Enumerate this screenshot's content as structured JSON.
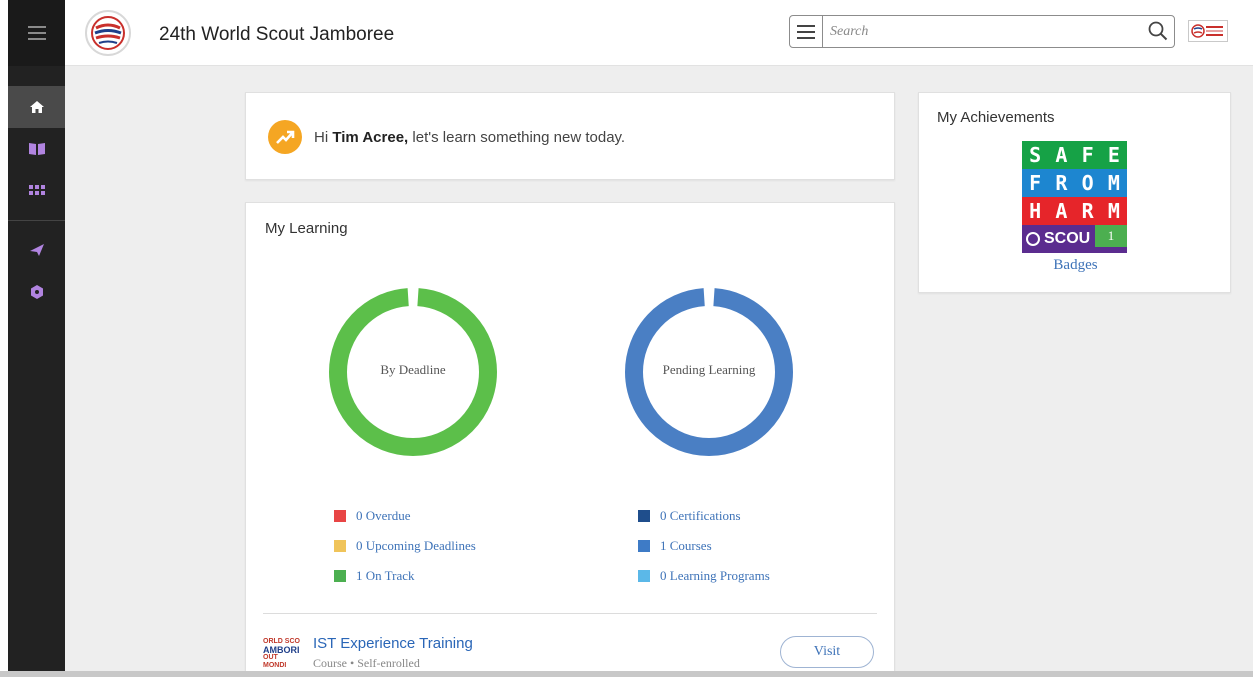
{
  "app": {
    "title": "24th World Scout Jamboree"
  },
  "sidebar": {
    "items": [
      {
        "name": "home",
        "icon": "home-icon",
        "active": true
      },
      {
        "name": "learning",
        "icon": "book-icon"
      },
      {
        "name": "apps",
        "icon": "grid-icon"
      },
      {
        "name": "send",
        "icon": "paper-plane-icon"
      },
      {
        "name": "badge",
        "icon": "hexagon-icon"
      }
    ],
    "accent": "#b184e0"
  },
  "search": {
    "placeholder": "Search"
  },
  "welcome": {
    "greeting_prefix": "Hi",
    "user_name": "Tim Acree,",
    "message": "let's learn something new today."
  },
  "my_learning": {
    "title": "My Learning",
    "donut_left_label": "By Deadline",
    "donut_right_label": "Pending Learning",
    "deadline_legend": [
      {
        "label": "0 Overdue",
        "color": "#e84545"
      },
      {
        "label": "0 Upcoming Deadlines",
        "color": "#f0c45a"
      },
      {
        "label": "1 On Track",
        "color": "#4caf50"
      }
    ],
    "pending_legend": [
      {
        "label": "0 Certifications",
        "color": "#1f4e8c"
      },
      {
        "label": "1 Courses",
        "color": "#3e7bc6"
      },
      {
        "label": "0 Learning Programs",
        "color": "#5bb8e8"
      }
    ],
    "course": {
      "thumb_lines": [
        "ORLD SCO",
        "AMBORI",
        "OUT MONDI"
      ],
      "title": "IST Experience Training",
      "meta": "Course • Self-enrolled",
      "action": "Visit"
    }
  },
  "achievements": {
    "title": "My Achievements",
    "badge_rows": [
      [
        "S",
        "A",
        "F",
        "E"
      ],
      [
        "F",
        "R",
        "O",
        "M"
      ],
      [
        "H",
        "A",
        "R",
        "M"
      ]
    ],
    "badge_footer": "SCOU",
    "badge_count": "1",
    "link": "Badges"
  },
  "colors": {
    "deadline_ring": "#5cbf4a",
    "pending_ring": "#4a7fc4"
  }
}
